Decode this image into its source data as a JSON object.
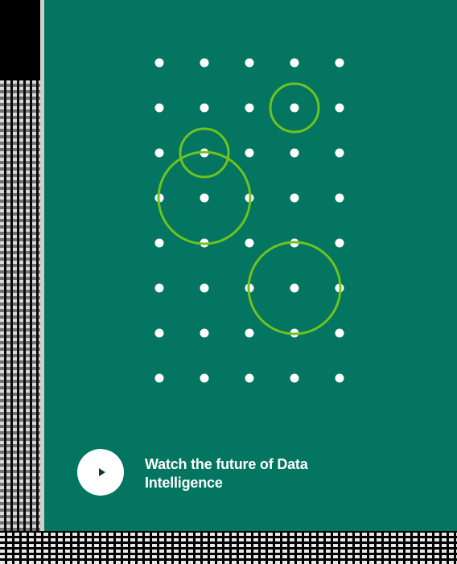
{
  "video_cta": {
    "text": "Watch the future of Data Intelligence",
    "play_icon": "play-icon"
  },
  "colors": {
    "panel_bg": "#037560",
    "dot": "#ffffff",
    "ring": "#6fc31e",
    "button_bg": "#ffffff"
  },
  "pattern": {
    "columns": 5,
    "rows": 8,
    "rings": [
      {
        "col": 3,
        "row": 1,
        "size": "small"
      },
      {
        "col": 1,
        "row": 2,
        "size": "small"
      },
      {
        "col": 1,
        "row": 3,
        "size": "large"
      },
      {
        "col": 3,
        "row": 5,
        "size": "large"
      }
    ]
  }
}
